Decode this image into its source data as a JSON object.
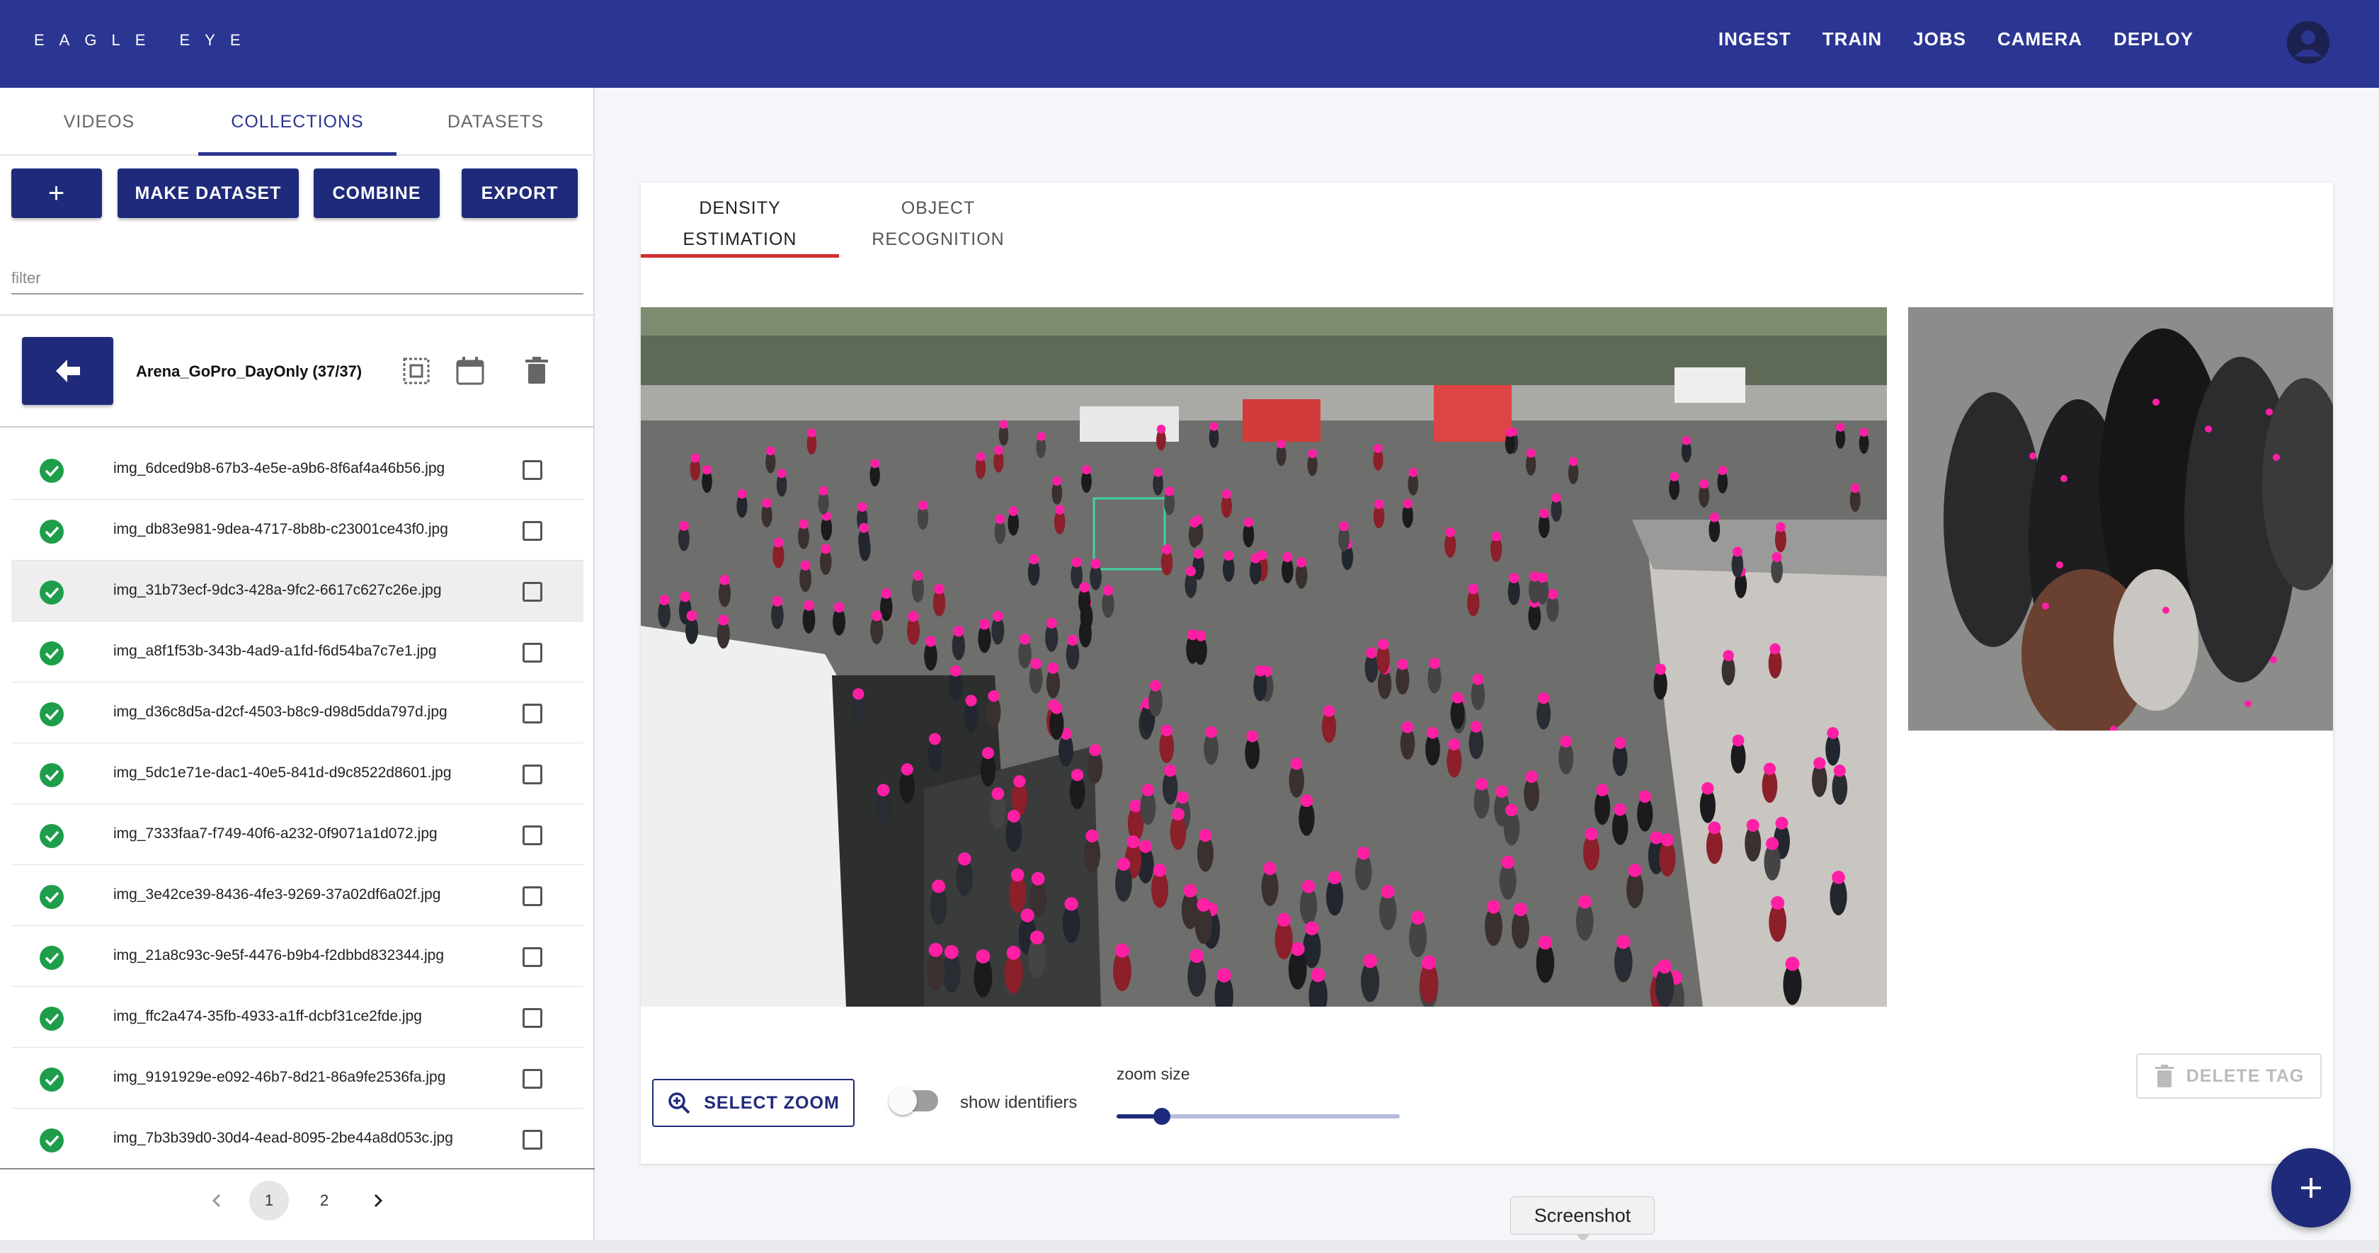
{
  "app": {
    "brand": "EAGLE EYE"
  },
  "nav": {
    "items": [
      "INGEST",
      "TRAIN",
      "JOBS",
      "CAMERA",
      "DEPLOY"
    ]
  },
  "sidebar": {
    "tabs": [
      "VIDEOS",
      "COLLECTIONS",
      "DATASETS"
    ],
    "active_tab": "COLLECTIONS",
    "buttons": {
      "add": "+",
      "make_dataset": "MAKE DATASET",
      "combine": "COMBINE",
      "export": "EXPORT"
    },
    "filter_placeholder": "filter",
    "collection": {
      "title": "Arena_GoPro_DayOnly (37/37)"
    },
    "files": [
      "img_6dced9b8-67b3-4e5e-a9b6-8f6af4a46b56.jpg",
      "img_db83e981-9dea-4717-8b8b-c23001ce43f0.jpg",
      "img_31b73ecf-9dc3-428a-9fc2-6617c627c26e.jpg",
      "img_a8f1f53b-343b-4ad9-a1fd-f6d54ba7c7e1.jpg",
      "img_d36c8d5a-d2cf-4503-b8c9-d98d5dda797d.jpg",
      "img_5dc1e71e-dac1-40e5-841d-d9c8522d8601.jpg",
      "img_7333faa7-f749-40f6-a232-0f9071a1d072.jpg",
      "img_3e42ce39-8436-4fe3-9269-37a02df6a02f.jpg",
      "img_21a8c93c-9e5f-4476-b9b4-f2dbbd832344.jpg",
      "img_ffc2a474-35fb-4933-a1ff-dcbf31ce2fde.jpg",
      "img_9191929e-e092-46b7-8d21-86a9fe2536fa.jpg",
      "img_7b3b39d0-30d4-4ead-8095-2be44a8d053c.jpg"
    ],
    "selected_index": 2,
    "pagination": {
      "pages": [
        "1",
        "2"
      ],
      "current": "1"
    }
  },
  "main": {
    "tabs": [
      {
        "line1": "DENSITY",
        "line2": "ESTIMATION"
      },
      {
        "line1": "OBJECT",
        "line2": "RECOGNITION"
      }
    ],
    "active_tab": 0,
    "select_zoom": "SELECT ZOOM",
    "show_identifiers": "show identifiers",
    "show_identifiers_on": false,
    "zoom_size_label": "zoom size",
    "zoom_size_fraction": 0.16,
    "delete_tag": "DELETE TAG",
    "fab": "+",
    "tooltip": "Screenshot"
  },
  "colors": {
    "primary": "#2b3592",
    "button": "#1f2a7a",
    "success": "#1e9e4b",
    "tab_indicator": "#d32f2f",
    "annotation": "#ff1fa5"
  }
}
